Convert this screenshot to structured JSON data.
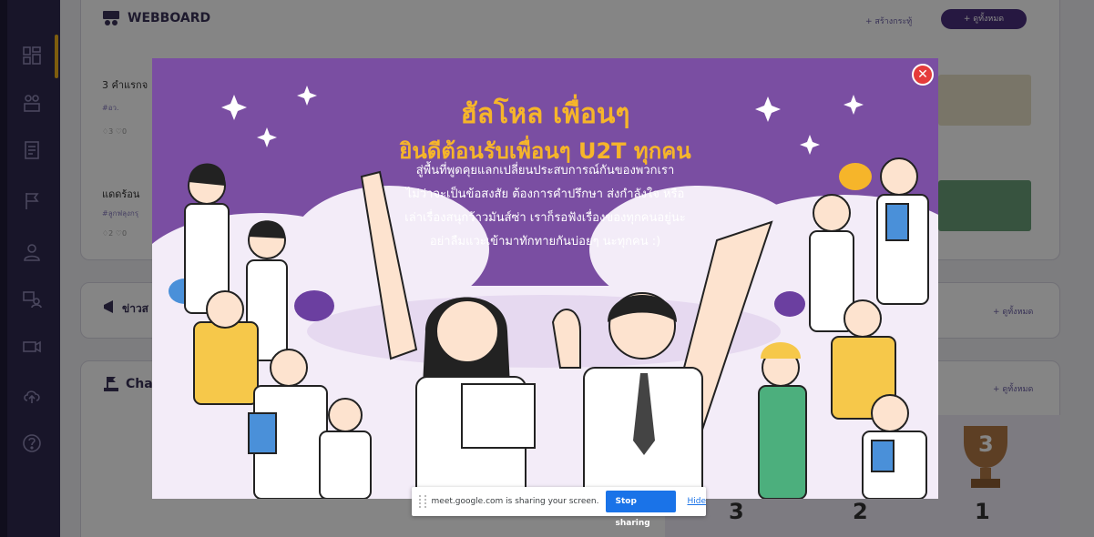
{
  "sidebar": {
    "items": [
      {
        "icon": "dashboard-icon"
      },
      {
        "icon": "community-icon"
      },
      {
        "icon": "document-icon"
      },
      {
        "icon": "flag-icon"
      },
      {
        "icon": "user-icon"
      },
      {
        "icon": "people-board-icon"
      },
      {
        "icon": "video-icon"
      },
      {
        "icon": "cloud-upload-icon"
      },
      {
        "icon": "help-icon"
      }
    ]
  },
  "webboard": {
    "title": "WEBBOARD",
    "create_label": "+ สร้างกระทู้",
    "view_all_label": "+ ดูทั้งหมด",
    "posts": [
      {
        "title": "3 คำแรกจ",
        "tag": "#อว.",
        "stats": "♢3 ♡0"
      },
      {
        "title": "แดดร้อน",
        "tag": "#ลูกฟลุงกรุ",
        "stats": "♢2 ♡0"
      }
    ]
  },
  "news": {
    "title": "ข่าวส",
    "view_all_label": "+ ดูทั้งหมด"
  },
  "challenge": {
    "title": "Cha",
    "view_all_label": "+ ดูทั้งหมด"
  },
  "ranking": {
    "values": [
      "3",
      "2",
      "1"
    ],
    "trophy_label": "3"
  },
  "modal": {
    "title_line1": "ฮัลโหล เพื่อนๆ",
    "title_line2": "ยินดีต้อนรับเพื่อนๆ U2T ทุกคน",
    "body_lines": [
      "สู่พื้นที่พูดคุยแลกเปลี่ยนประสบการณ์กันของพวกเรา",
      "ไม่ว่าจะเป็นข้อสงสัย ต้องการคำปรึกษา ส่งกำลังใจ หรือ",
      "เล่าเรื่องสนุกว้าวมันส์ซ่า เราก็รอฟังเรื่องของทุกคนอยู่นะ",
      "อย่าลืมแวะเข้ามาทักทายกันบ่อยๆ นะทุกคน :)"
    ],
    "close_symbol": "✕"
  },
  "share_bar": {
    "message": "meet.google.com is sharing your screen.",
    "stop_label": "Stop sharing",
    "hide_label": "Hide"
  },
  "colors": {
    "brand_purple": "#4a2f7e",
    "modal_purple": "#7a4ea2",
    "title_gold": "#f6b52a",
    "sidebar": "#2f2a4f",
    "google_blue": "#1a73e8"
  }
}
